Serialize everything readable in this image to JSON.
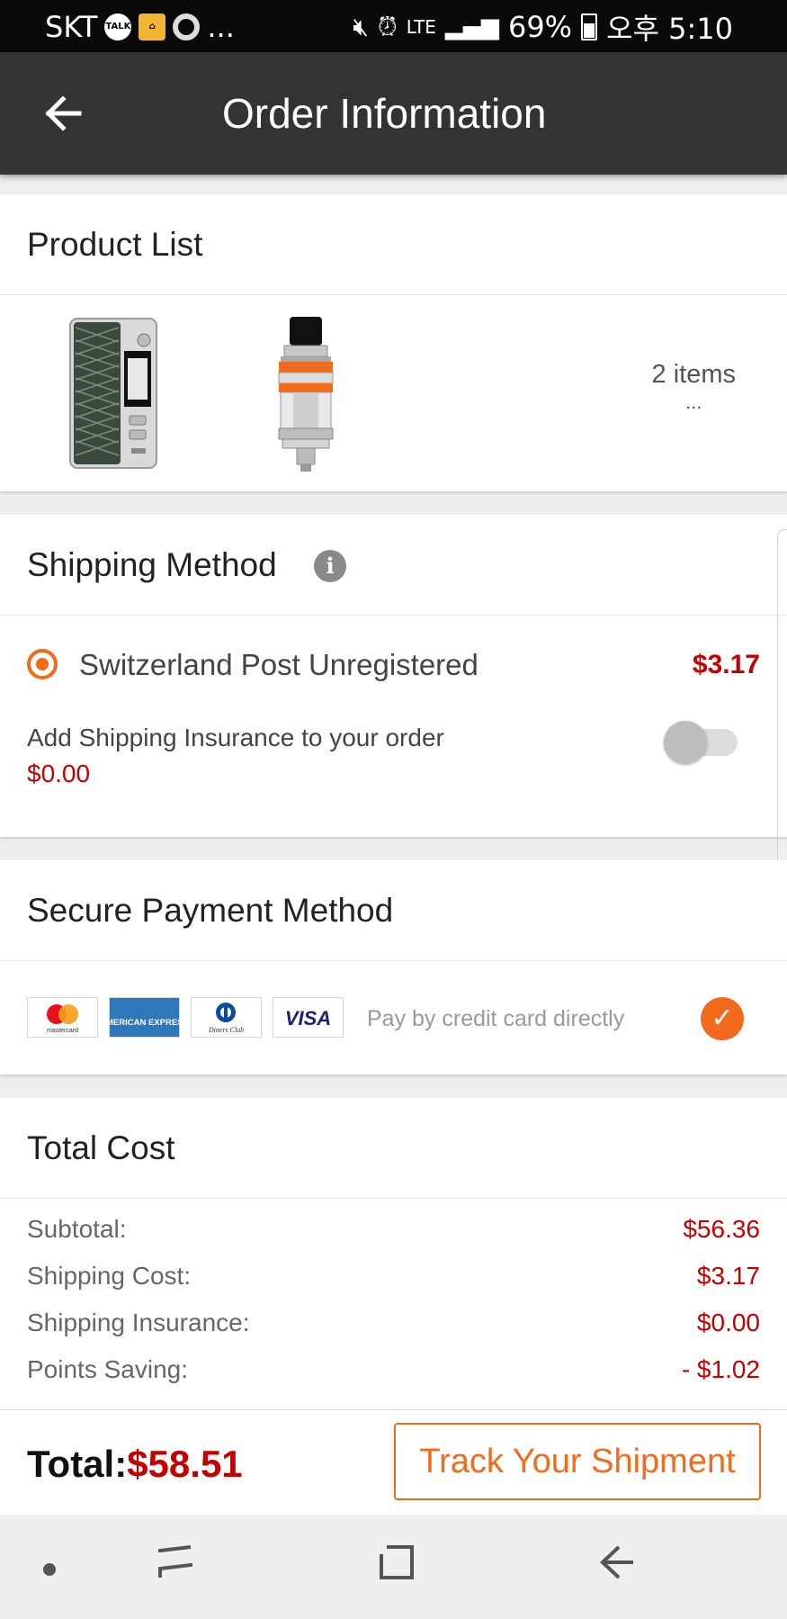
{
  "status_bar": {
    "carrier": "SKT",
    "ellipsis": "...",
    "network": "LTE",
    "battery": "69%",
    "time": "오후 5:10"
  },
  "header": {
    "title": "Order Information"
  },
  "product_list": {
    "title": "Product List",
    "count": "2 items",
    "more": "..."
  },
  "shipping": {
    "title": "Shipping Method",
    "option_label": "Switzerland Post Unregistered",
    "option_price": "$3.17",
    "insurance_label": "Add Shipping Insurance to your order",
    "insurance_price": "$0.00",
    "insurance_enabled": false
  },
  "payment": {
    "title": "Secure Payment Method",
    "cards": [
      "mastercard",
      "AMERICAN EXPRESS",
      "Diners Club",
      "VISA"
    ],
    "text": "Pay by credit card directly"
  },
  "total_cost": {
    "title": "Total Cost",
    "rows": [
      {
        "label": "Subtotal:",
        "value": "$56.36"
      },
      {
        "label": "Shipping Cost:",
        "value": "$3.17"
      },
      {
        "label": "Shipping Insurance:",
        "value": "$0.00"
      },
      {
        "label": "Points Saving:",
        "value": "- $1.02"
      }
    ]
  },
  "footer": {
    "total_label": "Total:",
    "total_amount": "$58.51",
    "track_button": "Track Your Shipment"
  },
  "colors": {
    "accent": "#f26a1b",
    "price": "#c40000",
    "appbar": "#333333"
  }
}
